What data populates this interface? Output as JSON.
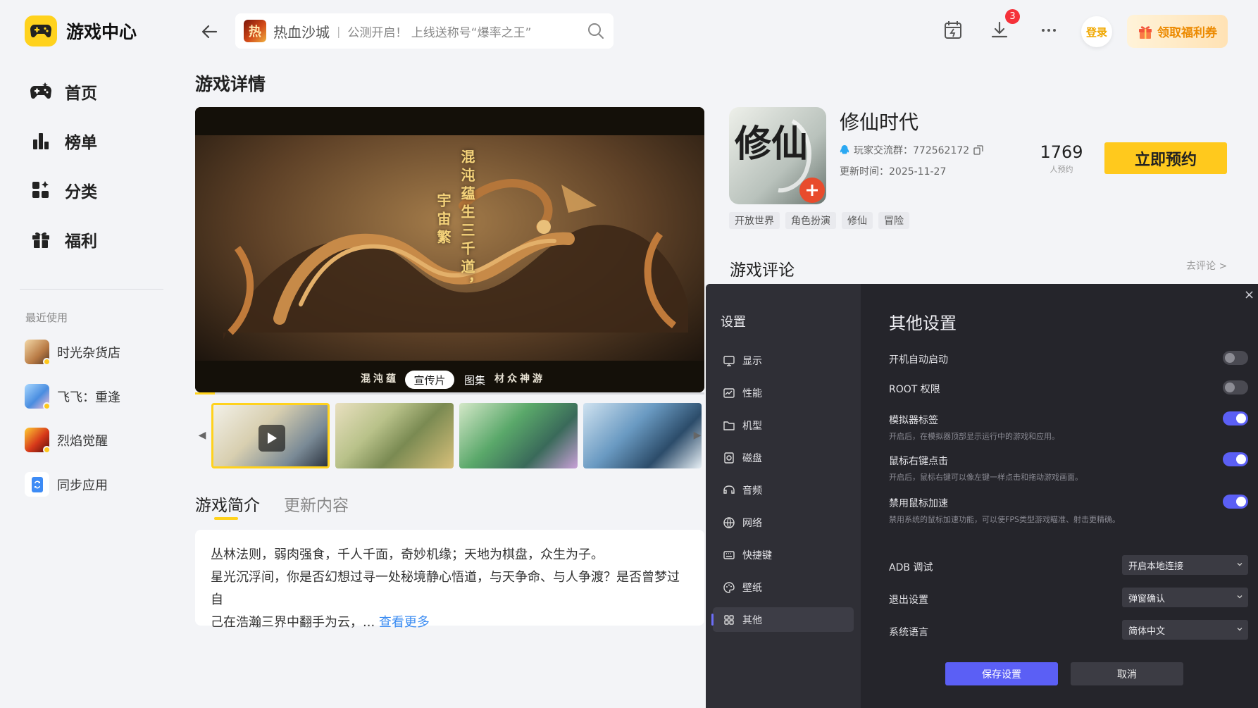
{
  "app": {
    "title": "游戏中心"
  },
  "sidebar": {
    "nav": [
      {
        "label": "首页",
        "icon": "gamepad-icon"
      },
      {
        "label": "榜单",
        "icon": "bar-chart-icon"
      },
      {
        "label": "分类",
        "icon": "category-icon"
      },
      {
        "label": "福利",
        "icon": "gift-icon"
      }
    ],
    "recent_title": "最近使用",
    "recent": [
      {
        "name": "时光杂货店"
      },
      {
        "name": "飞飞：重逢"
      },
      {
        "name": "烈焰觉醒"
      },
      {
        "name": "同步应用"
      }
    ]
  },
  "topbar": {
    "search_game": "热血沙城",
    "search_separator": "|",
    "search_hint": "公测开启！ 上线送称号“爆率之王”",
    "download_badge": "3",
    "login": "登录",
    "coupon": "领取福利券"
  },
  "page": {
    "title": "游戏详情"
  },
  "banner": {
    "tagline_1": "混沌蕴生三千道，",
    "tagline_2": "宇宙繁",
    "bottom_left": "混沌蕴",
    "bottom_right": "材众神游",
    "tab_video": "宣传片",
    "tab_gallery": "图集"
  },
  "tabs": {
    "intro": "游戏简介",
    "updates": "更新内容"
  },
  "intro": {
    "line1": "丛林法则，弱肉强食，千人千面，奇妙机缘；天地为棋盘，众生为子。",
    "line2": "星光沉浮间，你是否幻想过寻一处秘境静心悟道，与天争命、与人争渡？是否曾梦过自",
    "line3": "己在浩瀚三界中翻手为云，...",
    "more": "查看更多"
  },
  "game": {
    "icon_text": "修仙",
    "name": "修仙时代",
    "qq_group": "玩家交流群：772562172",
    "update_time": "更新时间：2025-11-27",
    "reserve_count": "1769",
    "reserve_unit": "人预约",
    "reserve_button": "立即预约",
    "tags": [
      "开放世界",
      "角色扮演",
      "修仙",
      "冒险"
    ]
  },
  "reviews": {
    "title": "游戏评论",
    "go": "去评论 >"
  },
  "settings": {
    "title": "设置",
    "close": "×",
    "nav": [
      {
        "label": "显示",
        "icon": "monitor-icon"
      },
      {
        "label": "性能",
        "icon": "performance-icon"
      },
      {
        "label": "机型",
        "icon": "folder-icon"
      },
      {
        "label": "磁盘",
        "icon": "disk-icon"
      },
      {
        "label": "音频",
        "icon": "audio-icon"
      },
      {
        "label": "网络",
        "icon": "globe-icon"
      },
      {
        "label": "快捷键",
        "icon": "keyboard-icon"
      },
      {
        "label": "壁纸",
        "icon": "palette-icon"
      },
      {
        "label": "其他",
        "icon": "grid-icon"
      }
    ],
    "selected_nav": "其他",
    "section_title": "其他设置",
    "toggles": [
      {
        "label": "开机自动启动",
        "desc": "",
        "on": false
      },
      {
        "label": "ROOT 权限",
        "desc": "",
        "on": false
      },
      {
        "label": "模拟器标签",
        "desc": "开启后，在模拟器顶部显示运行中的游戏和应用。",
        "on": true
      },
      {
        "label": "鼠标右键点击",
        "desc": "开启后，鼠标右键可以像左键一样点击和拖动游戏画面。",
        "on": true
      },
      {
        "label": "禁用鼠标加速",
        "desc": "禁用系统的鼠标加速功能，可以使FPS类型游戏瞄准、射击更精确。",
        "on": true
      }
    ],
    "selects": [
      {
        "label": "ADB 调试",
        "value": "开启本地连接"
      },
      {
        "label": "退出设置",
        "value": "弹窗确认"
      },
      {
        "label": "系统语言",
        "value": "简体中文"
      }
    ],
    "save": "保存设置",
    "cancel": "取消"
  },
  "colors": {
    "brand_yellow": "#ffd21d",
    "reserve_yellow": "#ffc91d",
    "toggle_on": "#5b5ff5",
    "link_blue": "#3b8cf2",
    "badge_red": "#f5313a",
    "panel_bg": "#25252b"
  }
}
